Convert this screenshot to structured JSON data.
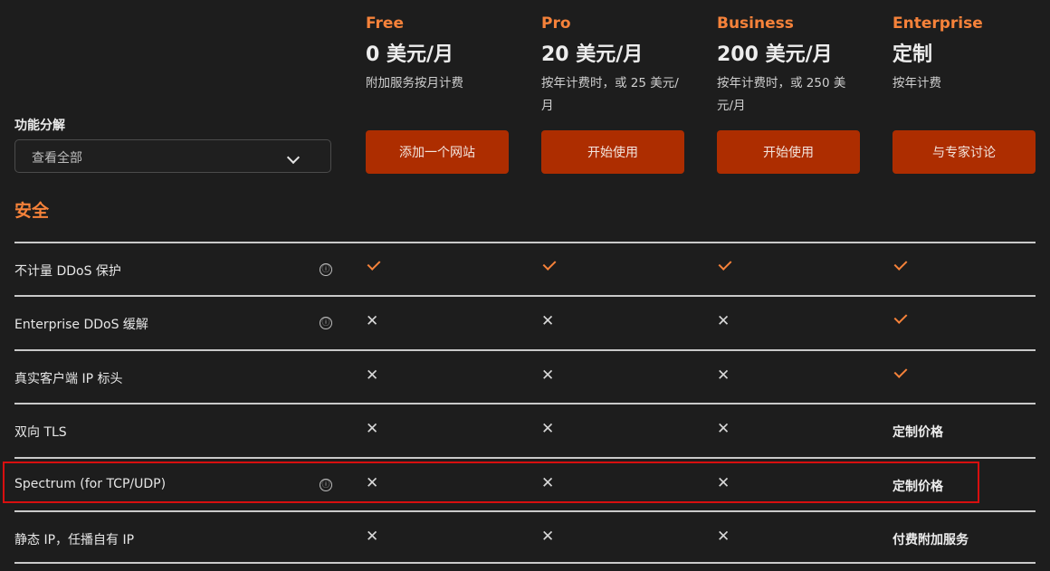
{
  "plans": [
    {
      "name": "Free",
      "price": "0 美元/月",
      "note": "附加服务按月计费",
      "button": "添加一个网站"
    },
    {
      "name": "Pro",
      "price": "20 美元/月",
      "note": "按年计费时，或 25 美元/月",
      "button": "开始使用"
    },
    {
      "name": "Business",
      "price": "200 美元/月",
      "note": "按年计费时，或 250 美元/月",
      "button": "开始使用"
    },
    {
      "name": "Enterprise",
      "price": "定制",
      "note": "按年计费",
      "button": "与专家讨论"
    }
  ],
  "filter": {
    "label": "功能分解",
    "selected": "查看全部"
  },
  "section": {
    "title": "安全"
  },
  "info_glyph": "ⓘ",
  "cross_glyph": "✕",
  "rows": [
    {
      "label": "不计量 DDoS 保护",
      "info": true,
      "cells": [
        {
          "type": "check"
        },
        {
          "type": "check"
        },
        {
          "type": "check"
        },
        {
          "type": "check"
        }
      ]
    },
    {
      "label": "Enterprise DDoS 缓解",
      "info": true,
      "cells": [
        {
          "type": "cross"
        },
        {
          "type": "cross"
        },
        {
          "type": "cross"
        },
        {
          "type": "check"
        }
      ]
    },
    {
      "label": "真实客户端 IP 标头",
      "info": false,
      "cells": [
        {
          "type": "cross"
        },
        {
          "type": "cross"
        },
        {
          "type": "cross"
        },
        {
          "type": "check"
        }
      ]
    },
    {
      "label": "双向 TLS",
      "info": false,
      "cells": [
        {
          "type": "cross"
        },
        {
          "type": "cross"
        },
        {
          "type": "cross"
        },
        {
          "type": "text",
          "text": "定制价格"
        }
      ]
    },
    {
      "label": "Spectrum (for TCP/UDP)",
      "info": true,
      "highlighted": true,
      "cells": [
        {
          "type": "cross"
        },
        {
          "type": "cross"
        },
        {
          "type": "cross"
        },
        {
          "type": "text",
          "text": "定制价格"
        }
      ]
    },
    {
      "label": "静态 IP，任播自有 IP",
      "info": false,
      "cells": [
        {
          "type": "cross"
        },
        {
          "type": "cross"
        },
        {
          "type": "cross"
        },
        {
          "type": "text",
          "text": "付费附加服务"
        }
      ]
    }
  ],
  "colors": {
    "accent": "#f6823a",
    "button": "#ad2d00",
    "background": "#1d1d1d",
    "highlight": "#d80f0f"
  }
}
